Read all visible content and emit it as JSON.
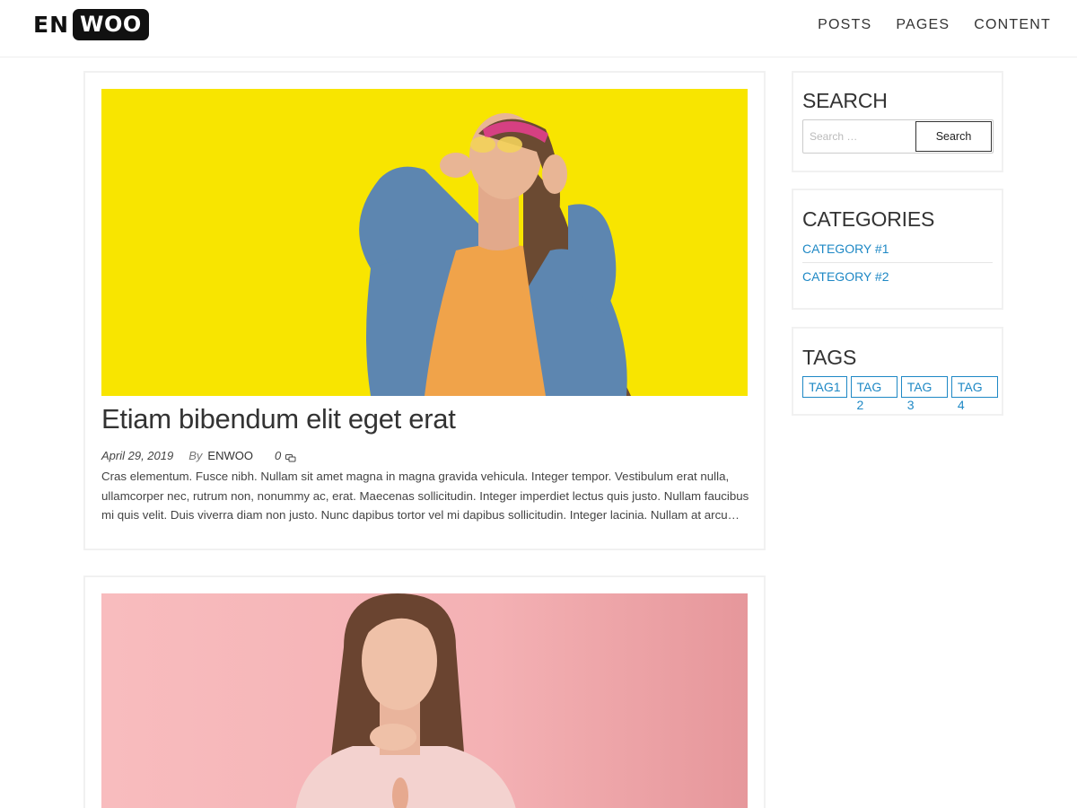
{
  "header": {
    "logo_en": "EN",
    "logo_woo": "WOO",
    "nav": [
      {
        "label": "POSTS"
      },
      {
        "label": "PAGES"
      },
      {
        "label": "CONTENT"
      }
    ]
  },
  "posts": [
    {
      "title": "Etiam bibendum elit eget erat",
      "date": "April 29, 2019",
      "by": "By",
      "author": "ENWOO",
      "comments": "0",
      "excerpt": "Cras elementum. Fusce nibh. Nullam sit amet magna in magna gravida vehicula. Integer tempor. Vestibulum erat nulla, ullamcorper nec, rutrum non, nonummy ac, erat. Maecenas sollicitudin. Integer imperdiet lectus quis justo. Nullam faucibus mi quis velit. Duis viverra diam non justo. Nunc dapibus tortor vel mi dapibus sollicitudin. Integer lacinia. Nullam at arcu…",
      "image_bg": "#f8e500"
    },
    {
      "image_bg": "#f5b3b6"
    }
  ],
  "sidebar": {
    "search": {
      "title": "SEARCH",
      "placeholder": "Search …",
      "button": "Search"
    },
    "categories": {
      "title": "CATEGORIES",
      "items": [
        {
          "label": "CATEGORY #1"
        },
        {
          "label": "CATEGORY #2"
        }
      ]
    },
    "tags": {
      "title": "TAGS",
      "items": [
        {
          "label": "TAG1"
        },
        {
          "label": "TAG 2"
        },
        {
          "label": "TAG 3"
        },
        {
          "label": "TAG 4"
        }
      ]
    }
  },
  "colors": {
    "link": "#1e88c5",
    "text": "#333333",
    "border": "#f1f1f1"
  }
}
